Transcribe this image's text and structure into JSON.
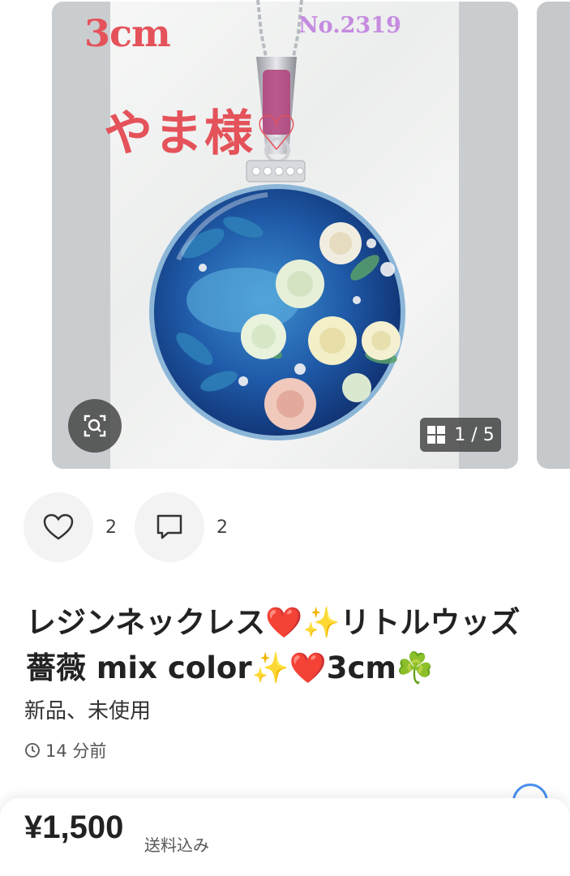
{
  "gallery": {
    "overlay_size_text": "3cm",
    "overlay_number_text": "No.2319",
    "overlay_name_text": "やま様♡",
    "counter": "1 / 5"
  },
  "actions": {
    "like_count": "2",
    "comment_count": "2"
  },
  "item": {
    "title": "レジンネックレス❤️✨リトルウッズ薔薇 mix color✨❤️3cm☘️",
    "condition": "新品、未使用",
    "posted": "14 分前"
  },
  "price": {
    "amount": "¥1,500",
    "shipping": "送料込み"
  },
  "colors": {
    "overlay_red": "#e4525a",
    "overlay_purple": "#c58be0"
  }
}
